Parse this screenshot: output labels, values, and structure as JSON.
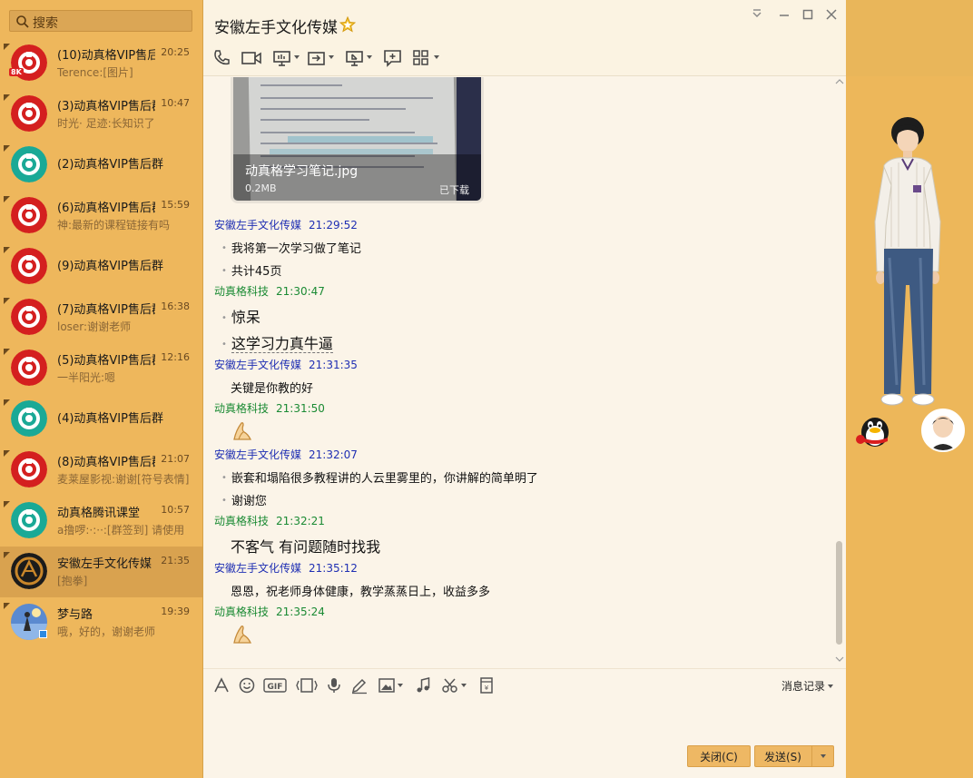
{
  "search": {
    "label": "搜索"
  },
  "conversations": [
    {
      "name": "(10)动真格VIP售后群",
      "time": "20:25",
      "preview": "Terence:[图片]",
      "avatar": "red-logo",
      "badge": "ek"
    },
    {
      "name": "(3)动真格VIP售后群",
      "time": "10:47",
      "preview": "时光· 足迹:长知识了",
      "avatar": "red-logo"
    },
    {
      "name": "(2)动真格VIP售后群",
      "time": "",
      "preview": "",
      "avatar": "teal-logo"
    },
    {
      "name": "(6)动真格VIP售后群",
      "time": "15:59",
      "preview": "神:最新的课程链接有吗",
      "avatar": "red-logo"
    },
    {
      "name": "(9)动真格VIP售后群",
      "time": "",
      "preview": "",
      "avatar": "red-logo"
    },
    {
      "name": "(7)动真格VIP售后群",
      "time": "16:38",
      "preview": "loser:谢谢老师",
      "avatar": "red-logo"
    },
    {
      "name": "(5)动真格VIP售后群",
      "time": "12:16",
      "preview": "一半阳光:嗯",
      "avatar": "red-logo"
    },
    {
      "name": "(4)动真格VIP售后群",
      "time": "",
      "preview": "",
      "avatar": "teal-logo"
    },
    {
      "name": "(8)动真格VIP售后群",
      "time": "21:07",
      "preview": "麦莱屋影视:谢谢[符号表情]",
      "avatar": "red-logo"
    },
    {
      "name": "动真格腾讯课堂",
      "time": "10:57",
      "preview": "a撸啰:·:··:[群签到] 请使用",
      "avatar": "teal-logo"
    },
    {
      "name": "安徽左手文化传媒",
      "time": "21:35",
      "preview": "[抱拳]",
      "avatar": "dark-logo",
      "active": true
    },
    {
      "name": "梦与路",
      "time": "19:39",
      "preview": "哦，好的，谢谢老师",
      "avatar": "photo"
    }
  ],
  "chat": {
    "title": "安徽左手文化传媒",
    "image": {
      "filename": "动真格学习笔记.jpg",
      "size": "0.2MB",
      "status": "已下载"
    },
    "messages": [
      {
        "sender": "安徽左手文化传媒",
        "time": "21:29:52",
        "lines": [
          "我将第一次学习做了笔记",
          "共计45页"
        ]
      },
      {
        "sender": "动真格科技",
        "time": "21:30:47",
        "lines": [
          "惊呆",
          "这学习力真牛逼"
        ]
      },
      {
        "sender": "安徽左手文化传媒",
        "time": "21:31:35",
        "lines": [
          "关键是你教的好"
        ]
      },
      {
        "sender": "动真格科技",
        "time": "21:31:50",
        "emoji": "fist-salute"
      },
      {
        "sender": "安徽左手文化传媒",
        "time": "21:32:07",
        "lines": [
          "嵌套和塌陷很多教程讲的人云里雾里的，你讲解的简单明了",
          "谢谢您"
        ]
      },
      {
        "sender": "动真格科技",
        "time": "21:32:21",
        "lines": [
          "不客气 有问题随时找我"
        ]
      },
      {
        "sender": "安徽左手文化传媒",
        "time": "21:35:12",
        "lines": [
          "恩恩，祝老师身体健康，教学蒸蒸日上，收益多多"
        ]
      },
      {
        "sender": "动真格科技",
        "time": "21:35:24",
        "emoji": "fist-salute"
      }
    ]
  },
  "input": {
    "history_label": "消息记录",
    "close_label": "关闭(C)",
    "send_label": "发送(S)"
  },
  "colors": {
    "sidebar": "#eeb75c",
    "chat_bg": "#fbf4e8",
    "sender_self": "#1f2fb3",
    "sender_other": "#1a8a33"
  }
}
